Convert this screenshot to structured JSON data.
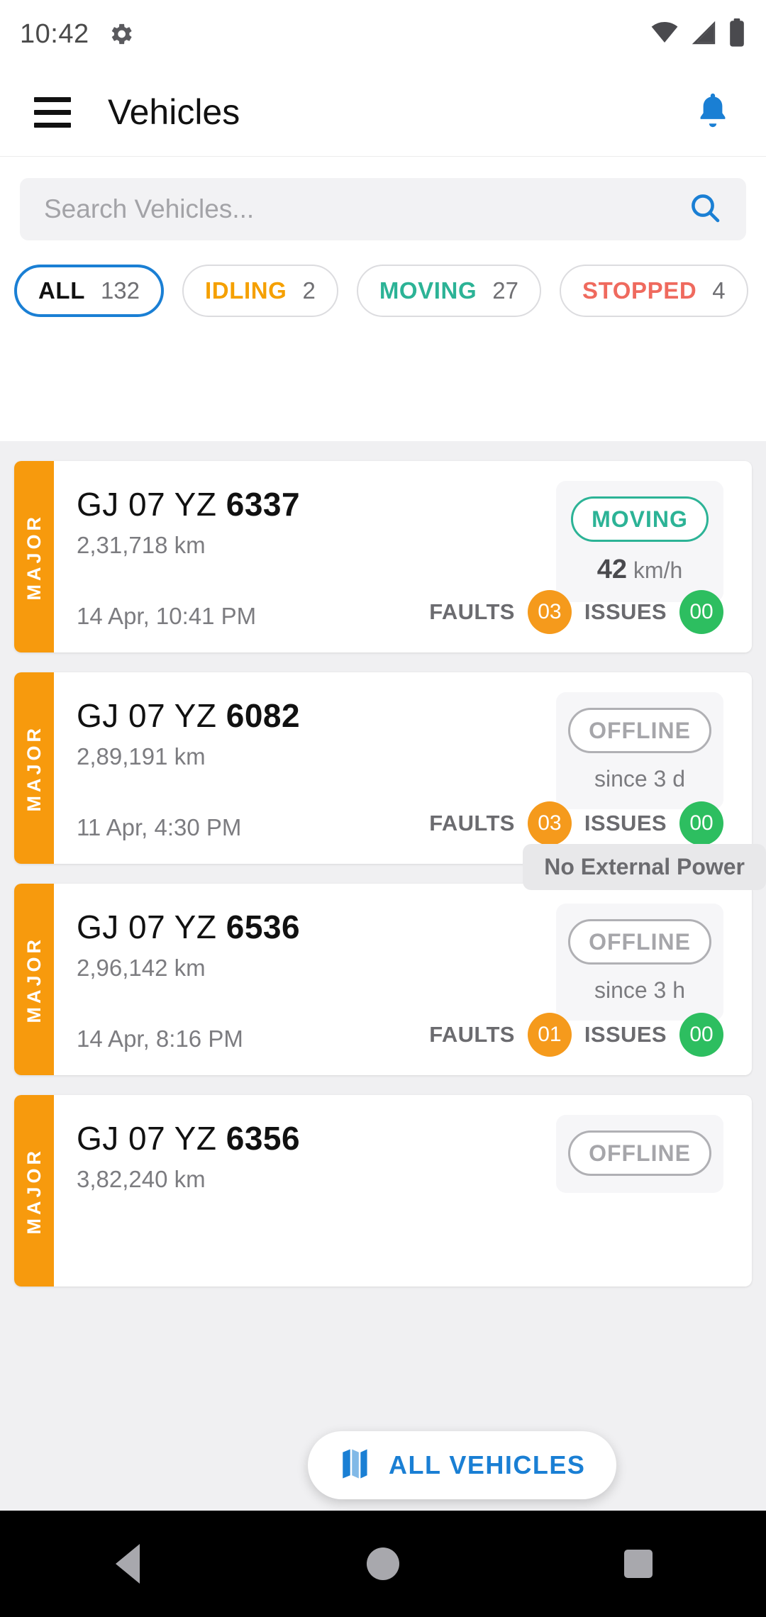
{
  "status_bar": {
    "time": "10:42",
    "gear_icon": "gear-icon",
    "wifi_icon": "wifi-icon",
    "signal_icon": "cellular-signal-icon",
    "battery_icon": "battery-icon"
  },
  "app_bar": {
    "menu_icon": "hamburger-menu-icon",
    "title": "Vehicles",
    "notification_icon": "bell-icon",
    "notification_color": "#1a7fd4"
  },
  "search": {
    "placeholder": "Search Vehicles...",
    "value": "",
    "icon": "search-icon",
    "icon_color": "#1a7fd4"
  },
  "filters": {
    "chips": [
      {
        "label": "ALL",
        "count": "132",
        "color": "#111111",
        "selected": true
      },
      {
        "label": "IDLING",
        "count": "2",
        "color": "#f5a000",
        "selected": false
      },
      {
        "label": "MOVING",
        "count": "27",
        "color": "#2cb396",
        "selected": false
      },
      {
        "label": "STOPPED",
        "count": "4",
        "color": "#ef6a5e",
        "selected": false
      }
    ],
    "selected_border_color": "#1a7fd4"
  },
  "vehicles": [
    {
      "severity": "MAJOR",
      "severity_color": "#f79a0d",
      "plate_prefix": "GJ 07 YZ ",
      "plate_number": "6337",
      "odometer": "2,31,718 km",
      "timestamp": "14 Apr, 10:41 PM",
      "status": "MOVING",
      "status_type": "moving",
      "status_color": "#2cb396",
      "speed_value": "42",
      "speed_unit": "km/h",
      "faults_label": "FAULTS",
      "faults_count": "03",
      "issues_label": "ISSUES",
      "issues_count": "00",
      "tag": null
    },
    {
      "severity": "MAJOR",
      "severity_color": "#f79a0d",
      "plate_prefix": "GJ 07 YZ ",
      "plate_number": "6082",
      "odometer": "2,89,191 km",
      "timestamp": "11 Apr, 4:30 PM",
      "status": "OFFLINE",
      "status_type": "offline",
      "status_color": "#a6a6aa",
      "since": "since 3 d",
      "faults_label": "FAULTS",
      "faults_count": "03",
      "issues_label": "ISSUES",
      "issues_count": "00",
      "tag": null
    },
    {
      "severity": "MAJOR",
      "severity_color": "#f79a0d",
      "plate_prefix": "GJ 07 YZ ",
      "plate_number": "6536",
      "odometer": "2,96,142 km",
      "timestamp": "14 Apr, 8:16 PM",
      "status": "OFFLINE",
      "status_type": "offline",
      "status_color": "#a6a6aa",
      "since": "since 3 h",
      "faults_label": "FAULTS",
      "faults_count": "01",
      "issues_label": "ISSUES",
      "issues_count": "00",
      "tag": "No External Power"
    },
    {
      "severity": "MAJOR",
      "severity_color": "#f79a0d",
      "plate_prefix": "GJ 07 YZ ",
      "plate_number": "6356",
      "odometer": "3,82,240 km",
      "timestamp": "",
      "status": "OFFLINE",
      "status_type": "offline",
      "status_color": "#a6a6aa",
      "since": "",
      "faults_label": "",
      "faults_count": "",
      "issues_label": "",
      "issues_count": "",
      "tag": null
    }
  ],
  "fab": {
    "label": "ALL VEHICLES",
    "icon": "map-icon",
    "color": "#1a7fd4"
  },
  "nav_bar": {
    "back_icon": "back-triangle-icon",
    "home_icon": "home-circle-icon",
    "recents_icon": "recents-square-icon"
  }
}
